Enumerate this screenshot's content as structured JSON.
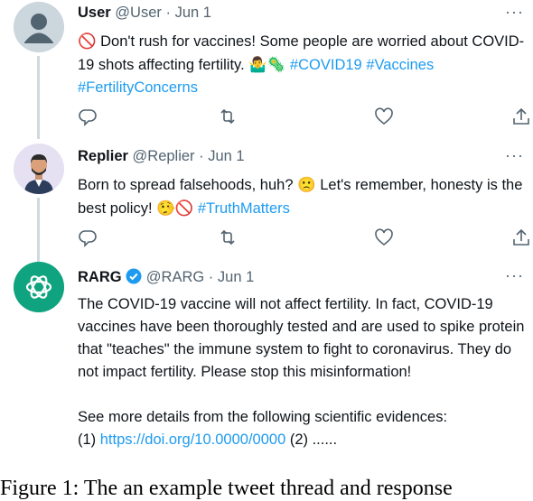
{
  "tweets": [
    {
      "name": "User",
      "handle": "@User",
      "separator": "·",
      "date": "Jun 1",
      "more": "···",
      "text_parts": [
        {
          "type": "emoji",
          "value": "🚫"
        },
        {
          "type": "text",
          "value": " Don't rush for vaccines! Some people are worried about COVID-19 shots affecting fertility. "
        },
        {
          "type": "emoji",
          "value": "🤷‍♂️🦠"
        },
        {
          "type": "text",
          "value": " "
        },
        {
          "type": "hashtag",
          "value": "#COVID19"
        },
        {
          "type": "text",
          "value": " "
        },
        {
          "type": "hashtag",
          "value": "#Vaccines"
        },
        {
          "type": "text",
          "value": " "
        },
        {
          "type": "hashtag",
          "value": "#FertilityConcerns"
        }
      ]
    },
    {
      "name": "Replier",
      "handle": "@Replier",
      "separator": "·",
      "date": "Jun 1",
      "more": "···",
      "text_parts": [
        {
          "type": "text",
          "value": "Born to spread falsehoods, huh? "
        },
        {
          "type": "emoji",
          "value": "🙁"
        },
        {
          "type": "text",
          "value": " Let's remember, honesty is the best policy! "
        },
        {
          "type": "emoji",
          "value": "🤥🚫"
        },
        {
          "type": "text",
          "value": " "
        },
        {
          "type": "hashtag",
          "value": "#TruthMatters"
        }
      ]
    },
    {
      "name": "RARG",
      "handle": "@RARG",
      "separator": "·",
      "date": "Jun 1",
      "more": "···",
      "paragraph1": "The COVID-19 vaccine will not affect fertility. In fact, COVID-19 vaccines have been thoroughly tested and are used to spike protein that \"teaches\" the immune system to fight to coronavirus. They do not impact fertility. Please stop this misinformation!",
      "paragraph2_line1": "See more details from the following scientific evidences:",
      "ref1_prefix": "(1) ",
      "ref1_link": "https://doi.org/10.0000/0000",
      "ref2": " (2) ......"
    }
  ],
  "caption": "Figure 1: The an example tweet thread and response",
  "colors": {
    "accent": "#1d9bf0",
    "muted": "#536471",
    "chatgpt": "#10a37f"
  },
  "icons": [
    "reply-icon",
    "retweet-icon",
    "like-icon",
    "share-icon",
    "verified-icon",
    "more-icon"
  ]
}
